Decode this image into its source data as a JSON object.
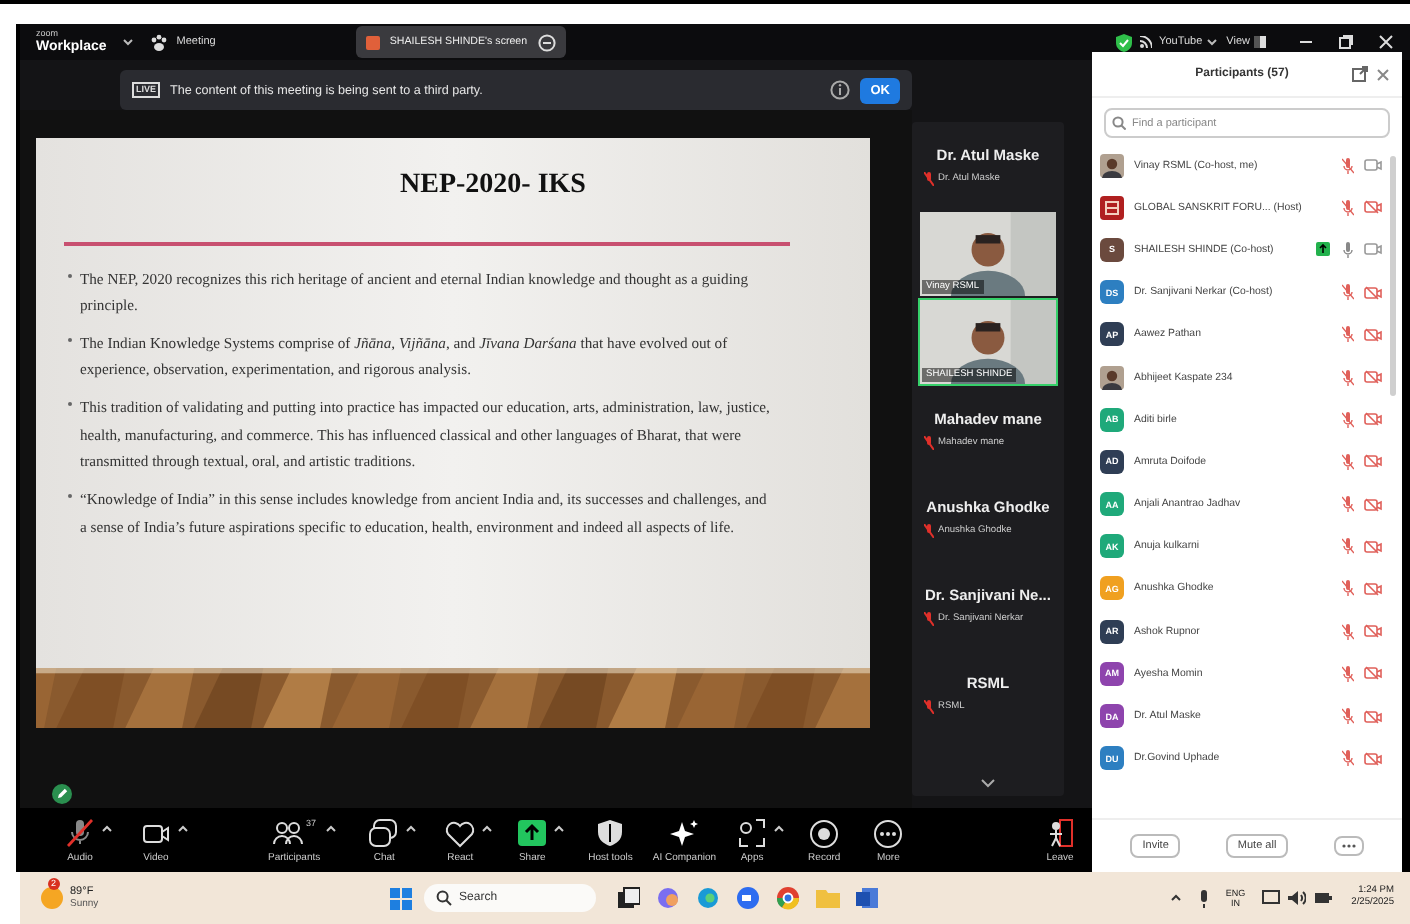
{
  "title_bar": {
    "brand_top": "zoom",
    "brand": "Workplace",
    "meeting": "Meeting",
    "screen_tab": "SHAILESH SHINDE's screen",
    "youtube": "YouTube",
    "view": "View"
  },
  "banner": {
    "live": "LIVE",
    "message": "The content of this meeting is being sent to a third party.",
    "ok": "OK"
  },
  "slide": {
    "title": "NEP-2020- IKS",
    "bullets": [
      "The NEP, 2020 recognizes this rich heritage of ancient and eternal Indian knowledge and thought as a guiding principle.",
      "The Indian Knowledge Systems comprise of *Jñāna*, *Vijñāna*, and *Jīvana Darśana* that have evolved out of experience, observation, experimentation, and rigorous analysis.",
      "This tradition of validating and putting into practice has impacted our education, arts, administration, law, justice, health, manufacturing, and commerce. This has influenced classical and other languages of Bharat, that were transmitted through textual, oral, and artistic traditions.",
      "“Knowledge of India” in this sense includes knowledge from ancient India and, its successes and challenges, and a sense of India’s future aspirations specific to education, health, environment and indeed all aspects of life."
    ]
  },
  "video_tiles": [
    {
      "kind": "name",
      "big_name": "Dr. Atul Maske",
      "label": "Dr. Atul Maske",
      "muted": true
    },
    {
      "kind": "video",
      "label": "Vinay RSML",
      "speaking": false
    },
    {
      "kind": "video",
      "label": "SHAILESH SHINDE",
      "speaking": true
    },
    {
      "kind": "name",
      "big_name": "Mahadev mane",
      "label": "Mahadev mane",
      "muted": true
    },
    {
      "kind": "name",
      "big_name": "Anushka Ghodke",
      "label": "Anushka Ghodke",
      "muted": true
    },
    {
      "kind": "name",
      "big_name": "Dr. Sanjivani Ne...",
      "label": "Dr. Sanjivani Nerkar",
      "muted": true
    },
    {
      "kind": "name",
      "big_name": "RSML",
      "label": "RSML",
      "muted": true
    }
  ],
  "participants_panel": {
    "title": "Participants (57)",
    "search_placeholder": "Find a participant",
    "participants": [
      {
        "name": "Vinay RSML (Co-host, me)",
        "kind": "picture",
        "muted": true,
        "video_stopped": false,
        "sharing": false
      },
      {
        "name": "GLOBAL SANSKRIT FORU... (Host)",
        "kind": "logo",
        "muted": true,
        "video_stopped": true,
        "sharing": false
      },
      {
        "name": "SHAILESH SHINDE (Co-host)",
        "kind": "initials",
        "initials": "S",
        "color": "#6b4a3e",
        "muted": false,
        "video_stopped": false,
        "sharing": true
      },
      {
        "name": "Dr. Sanjivani Nerkar (Co-host)",
        "kind": "initials",
        "initials": "DS",
        "color": "#2d7fc1",
        "muted": true,
        "video_stopped": true,
        "sharing": false
      },
      {
        "name": "Aawez Pathan",
        "kind": "initials",
        "initials": "AP",
        "color": "#2f3e55",
        "muted": true,
        "video_stopped": true,
        "sharing": false
      },
      {
        "name": "Abhijeet Kaspate 234",
        "kind": "picture",
        "muted": true,
        "video_stopped": true,
        "sharing": false
      },
      {
        "name": "Aditi birle",
        "kind": "initials",
        "initials": "AB",
        "color": "#1fa97a",
        "muted": true,
        "video_stopped": true,
        "sharing": false
      },
      {
        "name": "Amruta Doifode",
        "kind": "initials",
        "initials": "AD",
        "color": "#2f3e55",
        "muted": true,
        "video_stopped": true,
        "sharing": false
      },
      {
        "name": "Anjali Anantrao Jadhav",
        "kind": "initials",
        "initials": "AA",
        "color": "#1fa97a",
        "muted": true,
        "video_stopped": true,
        "sharing": false
      },
      {
        "name": "Anuja kulkarni",
        "kind": "initials",
        "initials": "AK",
        "color": "#1fa97a",
        "muted": true,
        "video_stopped": true,
        "sharing": false
      },
      {
        "name": "Anushka Ghodke",
        "kind": "initials",
        "initials": "AG",
        "color": "#f0a020",
        "muted": true,
        "video_stopped": true,
        "sharing": false
      },
      {
        "name": "Ashok Rupnor",
        "kind": "initials",
        "initials": "AR",
        "color": "#2f3e55",
        "muted": true,
        "video_stopped": true,
        "sharing": false
      },
      {
        "name": "Ayesha Momin",
        "kind": "initials",
        "initials": "AM",
        "color": "#8e44ad",
        "muted": true,
        "video_stopped": true,
        "sharing": false
      },
      {
        "name": "Dr. Atul Maske",
        "kind": "initials",
        "initials": "DA",
        "color": "#8e44ad",
        "muted": true,
        "video_stopped": true,
        "sharing": false
      },
      {
        "name": "Dr.Govind Uphade",
        "kind": "initials",
        "initials": "DU",
        "color": "#2d7fc1",
        "muted": true,
        "video_stopped": true,
        "sharing": false
      }
    ],
    "buttons": [
      "Invite",
      "Mute all"
    ]
  },
  "toolbar": [
    {
      "kind": "audio",
      "label": "Audio",
      "caret": true,
      "muted": true
    },
    {
      "kind": "video",
      "label": "Video",
      "caret": true
    },
    {
      "kind": "participants",
      "label": "Participants",
      "count": "37",
      "caret": true
    },
    {
      "kind": "chat",
      "label": "Chat",
      "caret": true
    },
    {
      "kind": "react",
      "label": "React",
      "caret": true
    },
    {
      "kind": "share",
      "label": "Share",
      "caret": true
    },
    {
      "kind": "host",
      "label": "Host tools",
      "caret": false
    },
    {
      "kind": "ai",
      "label": "AI Companion",
      "caret": false
    },
    {
      "kind": "apps",
      "label": "Apps",
      "caret": true
    },
    {
      "kind": "record",
      "label": "Record",
      "caret": false
    },
    {
      "kind": "more",
      "label": "More",
      "caret": false
    },
    {
      "kind": "leave",
      "label": "Leave",
      "caret": false
    }
  ],
  "taskbar": {
    "weather_badge": "2",
    "temperature": "89°F",
    "condition": "Sunny",
    "search": "Search",
    "language": "ENG",
    "region": "IN",
    "time": "1:24 PM",
    "date": "2/25/2025"
  }
}
